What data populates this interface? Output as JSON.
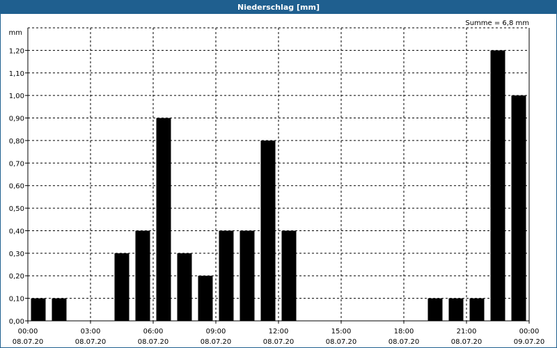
{
  "window": {
    "title": "Niederschlag [mm]"
  },
  "chart_data": {
    "type": "bar",
    "title": "Niederschlag [mm]",
    "ylabel": "mm",
    "annotation": "Summe = 6,8 mm",
    "ylim": [
      0,
      1.3
    ],
    "y_ticks": [
      "0,00",
      "0,10",
      "0,20",
      "0,30",
      "0,40",
      "0,50",
      "0,60",
      "0,70",
      "0,80",
      "0,90",
      "1,00",
      "1,10",
      "1,20"
    ],
    "x_ticks": [
      {
        "time": "00:00",
        "date": "08.07.20"
      },
      {
        "time": "03:00",
        "date": "08.07.20"
      },
      {
        "time": "06:00",
        "date": "08.07.20"
      },
      {
        "time": "09:00",
        "date": "08.07.20"
      },
      {
        "time": "12:00",
        "date": "08.07.20"
      },
      {
        "time": "15:00",
        "date": "08.07.20"
      },
      {
        "time": "18:00",
        "date": "08.07.20"
      },
      {
        "time": "21:00",
        "date": "08.07.20"
      },
      {
        "time": "00:00",
        "date": "09.07.20"
      }
    ],
    "categories": [
      "00:00",
      "01:00",
      "02:00",
      "03:00",
      "04:00",
      "05:00",
      "06:00",
      "07:00",
      "08:00",
      "09:00",
      "10:00",
      "11:00",
      "12:00",
      "13:00",
      "14:00",
      "15:00",
      "16:00",
      "17:00",
      "18:00",
      "19:00",
      "20:00",
      "21:00",
      "22:00",
      "23:00"
    ],
    "values": [
      0.1,
      0.1,
      0,
      0,
      0.3,
      0.4,
      0.9,
      0.3,
      0.2,
      0.4,
      0.4,
      0.8,
      0.4,
      0,
      0,
      0,
      0,
      0,
      0,
      0.1,
      0.1,
      0.1,
      1.2,
      1.0
    ],
    "bar_color": "#000000",
    "grid": true
  }
}
